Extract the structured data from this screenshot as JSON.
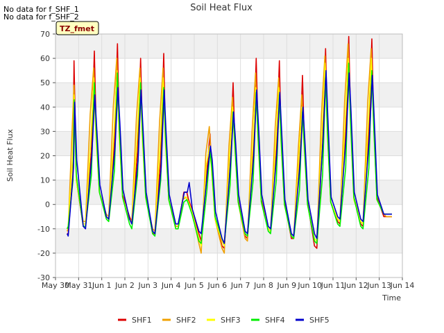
{
  "notes": [
    "No data for f_SHF_1",
    "No data for f_SHF_2"
  ],
  "chart_data": {
    "type": "line",
    "title": "Soil Heat Flux",
    "xlabel": "Time",
    "ylabel": "Soil Heat Flux",
    "tag": "TZ_fmet",
    "ylim": [
      -30,
      70
    ],
    "yticks": [
      -30,
      -20,
      -10,
      0,
      10,
      20,
      30,
      40,
      50,
      60,
      70
    ],
    "xlim": [
      0,
      15
    ],
    "xticks": [
      {
        "pos": 0,
        "label": "May 30"
      },
      {
        "pos": 1,
        "label": "May 31"
      },
      {
        "pos": 2,
        "label": "Jun 1"
      },
      {
        "pos": 3,
        "label": "Jun 2"
      },
      {
        "pos": 4,
        "label": "Jun 3"
      },
      {
        "pos": 5,
        "label": "Jun 4"
      },
      {
        "pos": 6,
        "label": "Jun 5"
      },
      {
        "pos": 7,
        "label": "Jun 6"
      },
      {
        "pos": 8,
        "label": "Jun 7"
      },
      {
        "pos": 9,
        "label": "Jun 8"
      },
      {
        "pos": 10,
        "label": "Jun 9"
      },
      {
        "pos": 11,
        "label": "Jun 10"
      },
      {
        "pos": 12,
        "label": "Jun 11"
      },
      {
        "pos": 13,
        "label": "Jun 12"
      },
      {
        "pos": 14,
        "label": "Jun 13"
      },
      {
        "pos": 15,
        "label": "Jun 14"
      }
    ],
    "grid": true,
    "legend_position": "bottom",
    "day_x_units": "days since May 30 00:00",
    "series": [
      {
        "name": "SHF1",
        "color": "#dd0000",
        "x": [
          0.5,
          0.55,
          0.75,
          0.8,
          0.9,
          1.2,
          1.3,
          1.55,
          1.68,
          1.75,
          1.9,
          2.2,
          2.3,
          2.55,
          2.68,
          2.75,
          2.9,
          3.2,
          3.3,
          3.55,
          3.68,
          3.75,
          3.9,
          4.2,
          4.3,
          4.55,
          4.68,
          4.75,
          4.9,
          5.2,
          5.3,
          5.55,
          5.68,
          5.75,
          5.9,
          6.2,
          6.3,
          6.55,
          6.68,
          6.75,
          6.9,
          7.2,
          7.3,
          7.55,
          7.68,
          7.75,
          7.9,
          8.2,
          8.3,
          8.55,
          8.68,
          8.75,
          8.9,
          9.2,
          9.3,
          9.55,
          9.68,
          9.75,
          9.9,
          10.2,
          10.3,
          10.55,
          10.68,
          10.75,
          10.9,
          11.2,
          11.3,
          11.55,
          11.68,
          11.75,
          11.9,
          12.2,
          12.3,
          12.55,
          12.68,
          12.75,
          12.9,
          13.2,
          13.3,
          13.55,
          13.68,
          13.75,
          13.9,
          14.2,
          14.3,
          14.55
        ],
        "y": [
          -12,
          -12,
          12,
          59,
          10,
          -9,
          -9,
          22,
          63,
          35,
          5,
          -5,
          -6,
          26,
          66,
          34,
          4,
          -5,
          -7,
          22,
          60,
          33,
          4,
          -12,
          -12,
          19,
          62,
          30,
          2,
          -9,
          -9,
          5,
          5,
          2,
          -2,
          -12,
          -15,
          14,
          29,
          15,
          -5,
          -17,
          -18,
          18,
          50,
          28,
          2,
          -13,
          -14,
          21,
          60,
          33,
          2,
          -10,
          -11,
          22,
          59,
          30,
          1,
          -14,
          -14,
          17,
          53,
          29,
          1,
          -17,
          -18,
          25,
          64,
          33,
          1,
          -7,
          -8,
          30,
          69,
          40,
          3,
          -8,
          -9,
          30,
          68,
          38,
          3,
          -5,
          -5,
          -5
        ]
      },
      {
        "name": "SHF2",
        "color": "#f0a000",
        "x": [
          0.5,
          0.55,
          0.72,
          0.8,
          0.9,
          1.2,
          1.3,
          1.5,
          1.65,
          1.75,
          1.9,
          2.2,
          2.3,
          2.5,
          2.65,
          2.75,
          2.9,
          3.2,
          3.3,
          3.5,
          3.65,
          3.75,
          3.9,
          4.2,
          4.3,
          4.5,
          4.65,
          4.75,
          4.9,
          5.2,
          5.3,
          5.5,
          5.65,
          5.75,
          5.9,
          6.2,
          6.3,
          6.5,
          6.65,
          6.75,
          6.9,
          7.2,
          7.3,
          7.5,
          7.65,
          7.75,
          7.9,
          8.2,
          8.3,
          8.5,
          8.65,
          8.75,
          8.9,
          9.2,
          9.3,
          9.5,
          9.65,
          9.75,
          9.9,
          10.2,
          10.3,
          10.5,
          10.65,
          10.75,
          10.9,
          11.2,
          11.3,
          11.5,
          11.65,
          11.75,
          11.9,
          12.2,
          12.3,
          12.5,
          12.65,
          12.75,
          12.9,
          13.2,
          13.3,
          13.5,
          13.65,
          13.75,
          13.9,
          14.2,
          14.3,
          14.55
        ],
        "y": [
          -11,
          -10,
          31,
          49,
          10,
          -7,
          -7,
          37,
          56,
          30,
          5,
          -4,
          -5,
          40,
          60,
          30,
          3,
          -6,
          -7,
          36,
          56,
          30,
          3,
          -10,
          -11,
          34,
          56,
          28,
          2,
          -9,
          -9,
          2,
          3,
          1,
          -3,
          -16,
          -20,
          21,
          32,
          15,
          -6,
          -18,
          -20,
          24,
          44,
          25,
          1,
          -14,
          -15,
          30,
          54,
          30,
          1,
          -10,
          -11,
          32,
          52,
          28,
          0,
          -13,
          -14,
          23,
          45,
          26,
          0,
          -15,
          -16,
          37,
          61,
          32,
          1,
          -6,
          -7,
          42,
          66,
          38,
          3,
          -7,
          -8,
          42,
          64,
          36,
          2,
          -4,
          -5,
          -5
        ]
      },
      {
        "name": "SHF3",
        "color": "#ffff00",
        "x": [
          0.5,
          0.55,
          0.74,
          0.8,
          0.9,
          1.2,
          1.3,
          1.52,
          1.66,
          1.75,
          1.9,
          2.2,
          2.3,
          2.52,
          2.66,
          2.75,
          2.9,
          3.2,
          3.3,
          3.52,
          3.66,
          3.75,
          3.9,
          4.2,
          4.3,
          4.52,
          4.66,
          4.75,
          4.9,
          5.2,
          5.3,
          5.52,
          5.66,
          5.75,
          5.9,
          6.2,
          6.3,
          6.52,
          6.66,
          6.75,
          6.9,
          7.2,
          7.3,
          7.52,
          7.66,
          7.75,
          7.9,
          8.2,
          8.3,
          8.52,
          8.66,
          8.75,
          8.9,
          9.2,
          9.3,
          9.52,
          9.66,
          9.75,
          9.9,
          10.2,
          10.3,
          10.52,
          10.66,
          10.75,
          10.9,
          11.2,
          11.3,
          11.52,
          11.66,
          11.75,
          11.9,
          12.2,
          12.3,
          12.52,
          12.66,
          12.75,
          12.9,
          13.2,
          13.3,
          13.52,
          13.66,
          13.75,
          13.9,
          14.2,
          14.3,
          14.55
        ],
        "y": [
          -10,
          -9,
          20,
          45,
          10,
          -8,
          -8,
          25,
          52,
          28,
          5,
          -5,
          -6,
          28,
          55,
          29,
          3,
          -6,
          -8,
          26,
          52,
          28,
          3,
          -11,
          -12,
          24,
          52,
          26,
          2,
          -10,
          -10,
          3,
          3,
          1,
          -3,
          -14,
          -17,
          16,
          24,
          14,
          -6,
          -15,
          -17,
          18,
          40,
          24,
          1,
          -12,
          -13,
          22,
          48,
          28,
          1,
          -10,
          -11,
          24,
          48,
          26,
          0,
          -13,
          -14,
          18,
          40,
          24,
          0,
          -14,
          -15,
          28,
          58,
          30,
          1,
          -6,
          -7,
          32,
          60,
          35,
          2,
          -7,
          -8,
          32,
          60,
          34,
          2,
          -4,
          -4,
          -4
        ]
      },
      {
        "name": "SHF4",
        "color": "#00ee00",
        "x": [
          0.5,
          0.55,
          0.76,
          0.81,
          0.9,
          1.2,
          1.3,
          1.55,
          1.68,
          1.76,
          1.9,
          2.2,
          2.3,
          2.55,
          2.68,
          2.76,
          2.9,
          3.2,
          3.3,
          3.55,
          3.68,
          3.76,
          3.9,
          4.2,
          4.3,
          4.55,
          4.68,
          4.76,
          4.9,
          5.2,
          5.3,
          5.55,
          5.68,
          5.76,
          5.9,
          6.2,
          6.3,
          6.55,
          6.68,
          6.76,
          6.9,
          7.2,
          7.3,
          7.55,
          7.68,
          7.76,
          7.9,
          8.2,
          8.3,
          8.55,
          8.68,
          8.76,
          8.9,
          9.2,
          9.3,
          9.55,
          9.68,
          9.76,
          9.9,
          10.2,
          10.3,
          10.55,
          10.68,
          10.76,
          10.9,
          11.2,
          11.3,
          11.55,
          11.68,
          11.76,
          11.9,
          12.2,
          12.3,
          12.55,
          12.68,
          12.76,
          12.9,
          13.2,
          13.3,
          13.55,
          13.68,
          13.76,
          13.9,
          14.2,
          14.3,
          14.55
        ],
        "y": [
          -10,
          -9,
          10,
          43,
          12,
          -9,
          -9,
          12,
          50,
          30,
          5,
          -6,
          -7,
          14,
          54,
          31,
          3,
          -8,
          -10,
          12,
          50,
          30,
          3,
          -12,
          -13,
          10,
          48,
          27,
          2,
          -10,
          -10,
          1,
          2,
          0,
          -4,
          -15,
          -16,
          6,
          22,
          15,
          -5,
          -14,
          -16,
          8,
          38,
          24,
          1,
          -12,
          -13,
          10,
          46,
          28,
          1,
          -11,
          -12,
          10,
          45,
          26,
          0,
          -13,
          -14,
          6,
          38,
          24,
          0,
          -15,
          -16,
          12,
          52,
          30,
          1,
          -8,
          -9,
          15,
          58,
          34,
          3,
          -9,
          -10,
          15,
          55,
          32,
          2,
          -4,
          -4,
          -4
        ]
      },
      {
        "name": "SHF5",
        "color": "#0000cc",
        "x": [
          0.5,
          0.55,
          0.78,
          0.83,
          0.92,
          1.2,
          1.3,
          1.57,
          1.7,
          1.78,
          1.92,
          2.2,
          2.3,
          2.57,
          2.7,
          2.78,
          2.92,
          3.2,
          3.3,
          3.57,
          3.7,
          3.78,
          3.92,
          4.2,
          4.3,
          4.57,
          4.7,
          4.78,
          4.92,
          5.2,
          5.3,
          5.57,
          5.7,
          5.78,
          5.92,
          6.2,
          6.3,
          6.57,
          6.7,
          6.78,
          6.92,
          7.2,
          7.3,
          7.57,
          7.7,
          7.78,
          7.92,
          8.2,
          8.3,
          8.57,
          8.7,
          8.78,
          8.92,
          9.2,
          9.3,
          9.57,
          9.7,
          9.78,
          9.92,
          10.2,
          10.3,
          10.57,
          10.7,
          10.78,
          10.92,
          11.2,
          11.3,
          11.57,
          11.7,
          11.78,
          11.92,
          12.2,
          12.3,
          12.57,
          12.7,
          12.78,
          12.92,
          13.2,
          13.3,
          13.57,
          13.7,
          13.78,
          13.92,
          14.2,
          14.3,
          14.55
        ],
        "y": [
          -12,
          -13,
          15,
          42,
          18,
          -9,
          -10,
          20,
          45,
          32,
          8,
          -5,
          -6,
          23,
          48,
          34,
          6,
          -6,
          -8,
          18,
          47,
          32,
          5,
          -11,
          -12,
          15,
          47,
          30,
          4,
          -8,
          -8,
          5,
          5,
          9,
          -2,
          -11,
          -12,
          13,
          24,
          18,
          -3,
          -14,
          -16,
          17,
          38,
          27,
          4,
          -11,
          -12,
          20,
          47,
          32,
          4,
          -9,
          -10,
          21,
          46,
          30,
          2,
          -12,
          -13,
          16,
          40,
          27,
          2,
          -12,
          -14,
          27,
          55,
          35,
          3,
          -5,
          -6,
          28,
          54,
          38,
          5,
          -6,
          -7,
          27,
          53,
          36,
          4,
          -4,
          -4,
          -4
        ]
      }
    ]
  }
}
